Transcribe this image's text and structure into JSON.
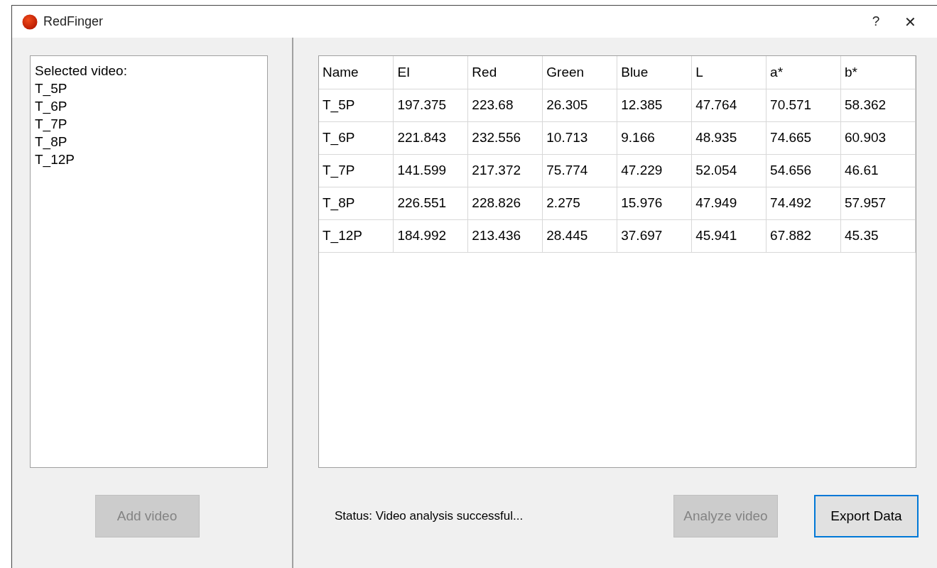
{
  "window": {
    "title": "RedFinger",
    "help": "?",
    "close": "✕"
  },
  "video_list": {
    "heading": "Selected video:",
    "items": [
      "T_5P",
      "T_6P",
      "T_7P",
      "T_8P",
      "T_12P"
    ]
  },
  "add_button": {
    "label": "Add video",
    "disabled": true,
    "focused": false
  },
  "table": {
    "columns": [
      "Name",
      "EI",
      "Red",
      "Green",
      "Blue",
      "L",
      "a*",
      "b*"
    ],
    "rows": [
      [
        "T_5P",
        "197.375",
        "223.68",
        "26.305",
        "12.385",
        "47.764",
        "70.571",
        "58.362"
      ],
      [
        "T_6P",
        "221.843",
        "232.556",
        "10.713",
        "9.166",
        "48.935",
        "74.665",
        "60.903"
      ],
      [
        "T_7P",
        "141.599",
        "217.372",
        "75.774",
        "47.229",
        "52.054",
        "54.656",
        "46.61"
      ],
      [
        "T_8P",
        "226.551",
        "228.826",
        "2.275",
        "15.976",
        "47.949",
        "74.492",
        "57.957"
      ],
      [
        "T_12P",
        "184.992",
        "213.436",
        "28.445",
        "37.697",
        "45.941",
        "67.882",
        "45.35"
      ]
    ]
  },
  "status": "Status: Video analysis successful...",
  "buttons": [
    {
      "label": "Analyze video",
      "disabled": true,
      "focused": false
    },
    {
      "label": "Export Data",
      "disabled": false,
      "focused": true
    }
  ]
}
